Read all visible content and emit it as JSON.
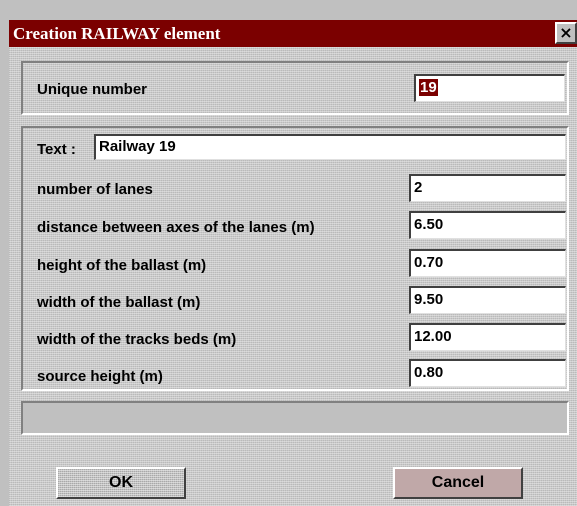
{
  "window": {
    "title": "Creation RAILWAY element",
    "close_symbol": "×",
    "accent_color": "#7b0000"
  },
  "unique_number": {
    "label": "Unique number",
    "value": "19"
  },
  "text_field": {
    "label": "Text :",
    "value": "Railway 19"
  },
  "params": [
    {
      "label": "number of lanes",
      "value": "2"
    },
    {
      "label": "distance between axes of the lanes (m)",
      "value": "6.50"
    },
    {
      "label": "height of the ballast (m)",
      "value": "0.70"
    },
    {
      "label": "width of the ballast (m)",
      "value": "9.50"
    },
    {
      "label": "width of the tracks beds (m)",
      "value": "12.00"
    },
    {
      "label": "source height (m)",
      "value": "0.80"
    }
  ],
  "buttons": {
    "ok": "OK",
    "cancel": "Cancel"
  }
}
